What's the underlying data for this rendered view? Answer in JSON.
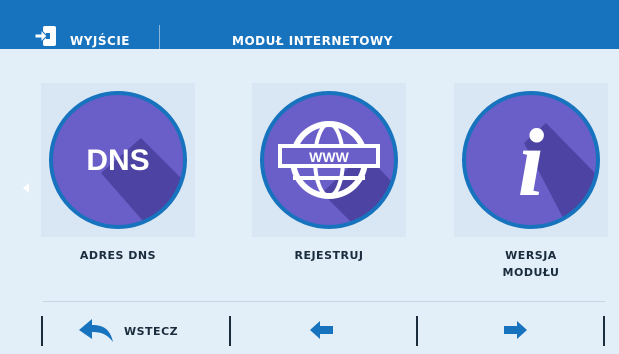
{
  "header": {
    "exit_label": "WYJŚCIE",
    "title": "MODUŁ INTERNETOWY"
  },
  "tiles": [
    {
      "icon": "dns-icon",
      "icon_text": "DNS",
      "label": "ADRES DNS"
    },
    {
      "icon": "www-globe-icon",
      "icon_text": "WWW",
      "label": "REJESTRUJ"
    },
    {
      "icon": "info-icon",
      "icon_text": "i",
      "label_lines": [
        "WERSJA",
        "MODUŁU"
      ]
    }
  ],
  "footer": {
    "back_label": "WSTECZ",
    "back_icon": "back-arrow-icon",
    "prev_icon": "arrow-left-icon",
    "next_icon": "arrow-right-icon"
  },
  "colors": {
    "header_bg": "#1873be",
    "screen_bg": "#e2eef8",
    "tile_bg": "#d8e7f3",
    "circle": "#6a5ec9",
    "circle_shadow": "#4d43a3",
    "accent": "#1873be",
    "text_dark": "#1b2c3d"
  }
}
